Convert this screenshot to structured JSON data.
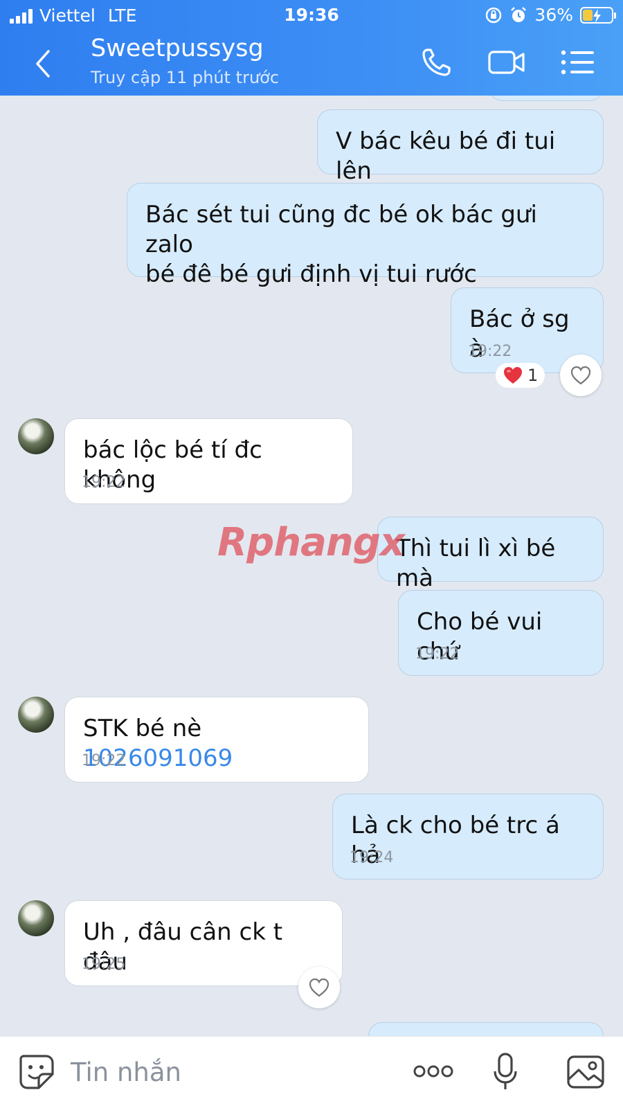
{
  "status_bar": {
    "carrier": "Viettel",
    "network": "LTE",
    "time": "19:36",
    "battery": "36%",
    "battery_level": 0.36,
    "icons": [
      "signal-icon",
      "orientation-lock-icon",
      "alarm-icon",
      "battery-charging-icon"
    ]
  },
  "header": {
    "title": "Sweetpussysg",
    "subtitle": "Truy cập 11 phút trước",
    "icons": [
      "back-icon",
      "phone-icon",
      "video-call-icon",
      "menu-icon"
    ]
  },
  "messages": [
    {
      "side": "out",
      "text": "V bác kêu bé đi tui lên",
      "time": ""
    },
    {
      "side": "out",
      "text_line1": "Bác sét tui cũng đc bé ok bác gưi zalo",
      "text_line2": "bé đê bé gưi định vị tui rước",
      "time": ""
    },
    {
      "side": "out",
      "text": "Bác ở sg à",
      "time": "19:22",
      "reaction": {
        "emoji": "❤️",
        "count": "1"
      }
    },
    {
      "side": "in",
      "text": "bác lộc bé tí đc không",
      "time": "19:22"
    },
    {
      "side": "out",
      "text": "Thì tui lì xì bé mà",
      "time": ""
    },
    {
      "side": "out",
      "text": "Cho bé vui chứ",
      "time": "19:22"
    },
    {
      "side": "in",
      "text": "STK bé nè ",
      "link": "1026091069",
      "time": "19:22"
    },
    {
      "side": "out",
      "text": "Là ck cho bé trc á hả",
      "time": "19:24"
    },
    {
      "side": "in",
      "text": "Uh , đâu cân ck t đâu",
      "time": "19:25"
    }
  ],
  "watermark": "Rphangx",
  "input_bar": {
    "placeholder": "Tin nhắn",
    "icons": [
      "sticker-icon",
      "more-icon",
      "microphone-icon",
      "image-icon"
    ]
  },
  "colors": {
    "header": "#3d8ff5",
    "outgoing_bubble": "#d6ebfb",
    "incoming_bubble": "#ffffff",
    "chat_background": "#e3e8f0",
    "link": "#3a88e8",
    "heart": "#e5333f"
  }
}
